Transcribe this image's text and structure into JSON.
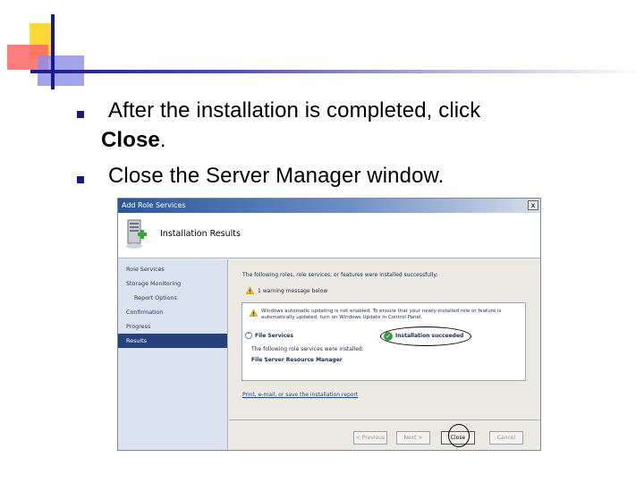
{
  "slide": {
    "bullet1_line1": "After the installation is completed, click",
    "bullet1_line2_bold": "Close",
    "bullet1_line2_tail": ".",
    "bullet2": "Close the Server Manager window."
  },
  "dialog": {
    "title": "Add Role Services",
    "close_glyph": "x",
    "header_title": "Installation Results",
    "nav": [
      "Role Services",
      "Storage Monitoring",
      "Report Options",
      "Confirmation",
      "Progress",
      "Results"
    ],
    "active_nav": "Results",
    "intro_text": "The following roles, role services, or features were installed successfully:",
    "warning_count": "1 warning message below",
    "warning_text_line1": "Windows automatic updating is not enabled. To ensure that your newly-installed role or feature is",
    "warning_text_line2": "automatically updated, turn on Windows Update in Control Panel.",
    "role_name": "File Services",
    "status": "Installation succeeded",
    "installed_intro": "The following role services were installed:",
    "installed_item": "File Server Resource Manager",
    "report_link": "Print, e-mail, or save the installation report",
    "buttons": {
      "previous": "< Previous",
      "next": "Next >",
      "close": "Close",
      "cancel": "Cancel"
    }
  },
  "colors": {
    "title_bar": "#2b5797",
    "nav_active": "#25427a",
    "success": "#3c9b3c",
    "warning": "#f0c020"
  }
}
